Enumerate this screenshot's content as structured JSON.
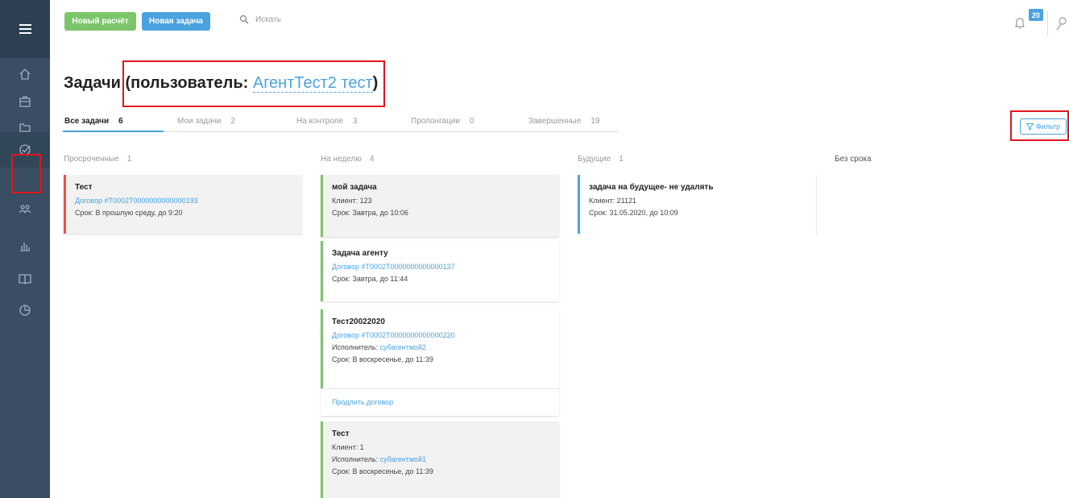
{
  "topbar": {
    "new_calc_label": "Новый расчёт",
    "new_task_label": "Новая задача",
    "search_placeholder": "Искать",
    "notifications_count": "20"
  },
  "page": {
    "title_prefix": "Задачи",
    "title_open": " (пользователь: ",
    "user_name": "АгентТест2 тест",
    "title_close": ")"
  },
  "tabs": [
    {
      "label": "Все задачи",
      "count": "6"
    },
    {
      "label": "Мои задачи",
      "count": "2"
    },
    {
      "label": "На контроле",
      "count": "3"
    },
    {
      "label": "Пролонгации",
      "count": "0"
    },
    {
      "label": "Завершенные",
      "count": "19"
    }
  ],
  "filter_label": "Фильтр",
  "columns": [
    {
      "label": "Просроченные",
      "count": "1"
    },
    {
      "label": "На неделю",
      "count": "4"
    },
    {
      "label": "Будущие",
      "count": "1"
    },
    {
      "label": "Без срока",
      "count": ""
    }
  ],
  "cards": {
    "overdue": [
      {
        "title": "Тест",
        "contract": "Договор #Т0002Т0000000000000193",
        "due": "Срок: В прошлую среду, до 9:20"
      }
    ],
    "week": [
      {
        "title": "мой задача",
        "client": "Клиент: 123",
        "due": "Срок: Завтра, до 10:06"
      },
      {
        "title": "Задача агенту",
        "contract": "Договор #Т0002Т0000000000000137",
        "due": "Срок: Завтра, до 11:44"
      },
      {
        "title": "Тест20022020",
        "contract": "Договор #Т0002Т0000000000000220",
        "executor_label": "Исполнитель: ",
        "executor": "субагентмой2",
        "due": "Срок: В воскресенье, до 11:39",
        "action": "Продлить договор"
      },
      {
        "title": "Тест",
        "client": "Клиент: 1",
        "executor_label": "Исполнитель: ",
        "executor": "субагентмой1",
        "due": "Срок: В воскресенье, до 11:39"
      }
    ],
    "future": [
      {
        "title": "задача на будущее- не удалять",
        "client": "Клиент: 21121",
        "due": "Срок: 31.05.2020, до 10:09"
      }
    ]
  },
  "colors": {
    "accent": "#4aa3de",
    "green": "#7cc56a",
    "overdue": "#e8524a",
    "highlight": "#e0161d",
    "sidebar": "#3a4d62"
  }
}
